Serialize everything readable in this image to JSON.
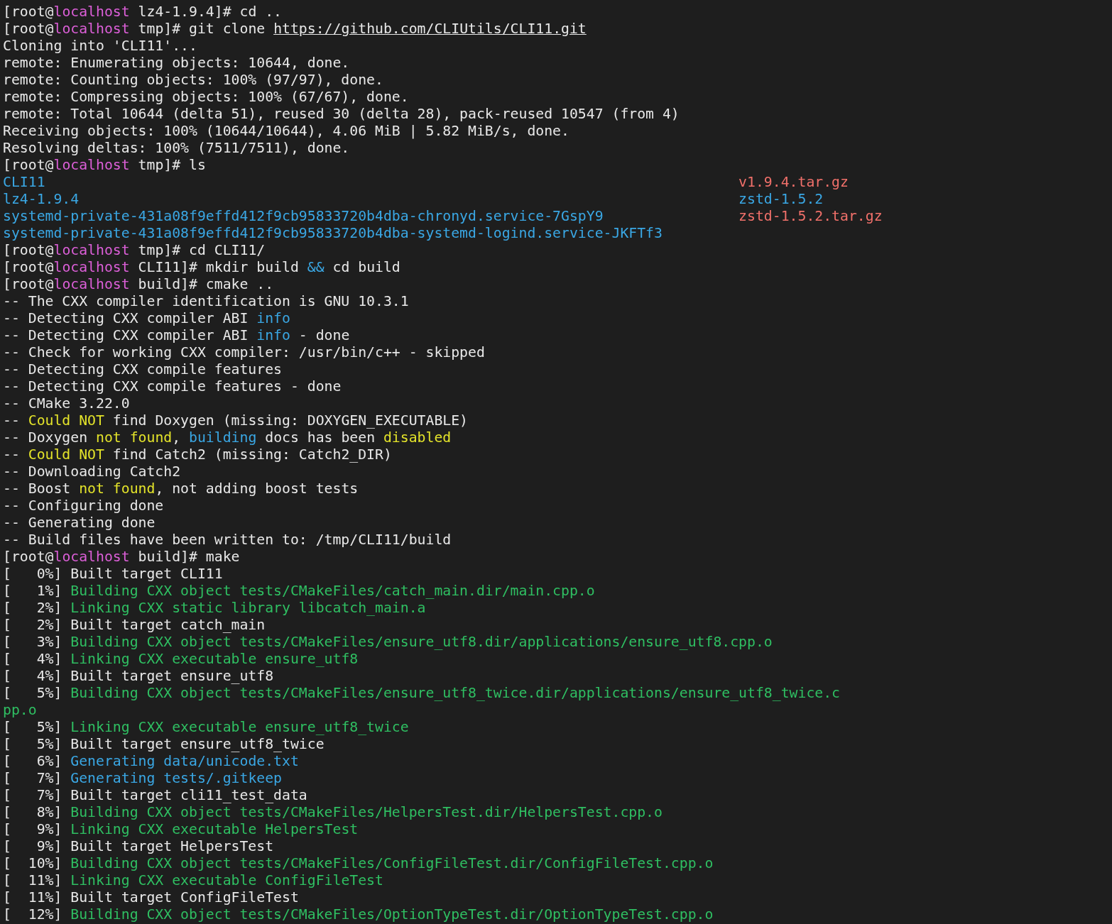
{
  "terminal": {
    "lines": [
      {
        "segments": [
          {
            "text": "[root@",
            "kind": "plain"
          },
          {
            "text": "localhost",
            "kind": "host"
          },
          {
            "text": " lz4-1.9.4]# cd ..",
            "kind": "plain"
          }
        ]
      },
      {
        "segments": [
          {
            "text": "[root@",
            "kind": "plain"
          },
          {
            "text": "localhost",
            "kind": "host"
          },
          {
            "text": " tmp]# git clone ",
            "kind": "plain"
          },
          {
            "text": "https://github.com/CLIUtils/CLI11.git",
            "kind": "link"
          }
        ]
      },
      {
        "segments": [
          {
            "text": "Cloning into 'CLI11'...",
            "kind": "plain"
          }
        ]
      },
      {
        "segments": [
          {
            "text": "remote: Enumerating objects: 10644, done.",
            "kind": "plain"
          }
        ]
      },
      {
        "segments": [
          {
            "text": "remote: Counting objects: 100% (97/97), done.",
            "kind": "plain"
          }
        ]
      },
      {
        "segments": [
          {
            "text": "remote: Compressing objects: 100% (67/67), done.",
            "kind": "plain"
          }
        ]
      },
      {
        "segments": [
          {
            "text": "remote: Total 10644 (delta 51), reused 30 (delta 28), pack-reused 10547 (from 4)",
            "kind": "plain"
          }
        ]
      },
      {
        "segments": [
          {
            "text": "Receiving objects: 100% (10644/10644), 4.06 MiB | 5.82 MiB/s, done.",
            "kind": "plain"
          }
        ]
      },
      {
        "segments": [
          {
            "text": "Resolving deltas: 100% (7511/7511), done.",
            "kind": "plain"
          }
        ]
      },
      {
        "segments": [
          {
            "text": "[root@",
            "kind": "plain"
          },
          {
            "text": "localhost",
            "kind": "host"
          },
          {
            "text": " tmp]# ls",
            "kind": "plain"
          }
        ]
      },
      {
        "cells": [
          {
            "text": "CLI11",
            "kind": "dir"
          },
          {
            "text": "v1.9.4.tar.gz",
            "kind": "archive"
          }
        ]
      },
      {
        "cells": [
          {
            "text": "lz4-1.9.4",
            "kind": "dir"
          },
          {
            "text": "zstd-1.5.2",
            "kind": "dir"
          }
        ]
      },
      {
        "cells": [
          {
            "text": "systemd-private-431a08f9effd412f9cb95833720b4dba-chronyd.service-7GspY9",
            "kind": "dir"
          },
          {
            "text": "zstd-1.5.2.tar.gz",
            "kind": "archive"
          }
        ]
      },
      {
        "cells": [
          {
            "text": "systemd-private-431a08f9effd412f9cb95833720b4dba-systemd-logind.service-JKFTf3",
            "kind": "dir"
          }
        ]
      },
      {
        "segments": [
          {
            "text": "[root@",
            "kind": "plain"
          },
          {
            "text": "localhost",
            "kind": "host"
          },
          {
            "text": " tmp]# cd CLI11/",
            "kind": "plain"
          }
        ]
      },
      {
        "segments": [
          {
            "text": "[root@",
            "kind": "plain"
          },
          {
            "text": "localhost",
            "kind": "host"
          },
          {
            "text": " CLI11]# mkdir build ",
            "kind": "plain"
          },
          {
            "text": "&&",
            "kind": "blue"
          },
          {
            "text": " cd build",
            "kind": "plain"
          }
        ]
      },
      {
        "segments": [
          {
            "text": "[root@",
            "kind": "plain"
          },
          {
            "text": "localhost",
            "kind": "host"
          },
          {
            "text": " build]# cmake ..",
            "kind": "plain"
          }
        ]
      },
      {
        "segments": [
          {
            "text": "-- The CXX compiler identification is GNU 10.3.1",
            "kind": "plain"
          }
        ]
      },
      {
        "segments": [
          {
            "text": "-- Detecting CXX compiler ABI ",
            "kind": "plain"
          },
          {
            "text": "info",
            "kind": "blue"
          }
        ]
      },
      {
        "segments": [
          {
            "text": "-- Detecting CXX compiler ABI ",
            "kind": "plain"
          },
          {
            "text": "info",
            "kind": "blue"
          },
          {
            "text": " - done",
            "kind": "plain"
          }
        ]
      },
      {
        "segments": [
          {
            "text": "-- Check for working CXX compiler: /usr/bin/c++ - skipped",
            "kind": "plain"
          }
        ]
      },
      {
        "segments": [
          {
            "text": "-- Detecting CXX compile features",
            "kind": "plain"
          }
        ]
      },
      {
        "segments": [
          {
            "text": "-- Detecting CXX compile features - done",
            "kind": "plain"
          }
        ]
      },
      {
        "segments": [
          {
            "text": "-- CMake 3.22.0",
            "kind": "plain"
          }
        ]
      },
      {
        "segments": [
          {
            "text": "-- ",
            "kind": "plain"
          },
          {
            "text": "Could NOT",
            "kind": "yellow"
          },
          {
            "text": " find Doxygen (missing: DOXYGEN_EXECUTABLE)",
            "kind": "plain"
          }
        ]
      },
      {
        "segments": [
          {
            "text": "-- Doxygen ",
            "kind": "plain"
          },
          {
            "text": "not found",
            "kind": "yellow"
          },
          {
            "text": ", ",
            "kind": "plain"
          },
          {
            "text": "building",
            "kind": "blue"
          },
          {
            "text": " docs has been ",
            "kind": "plain"
          },
          {
            "text": "disabled",
            "kind": "yellow"
          }
        ]
      },
      {
        "segments": [
          {
            "text": "-- ",
            "kind": "plain"
          },
          {
            "text": "Could NOT",
            "kind": "yellow"
          },
          {
            "text": " find Catch2 (missing: Catch2_DIR)",
            "kind": "plain"
          }
        ]
      },
      {
        "segments": [
          {
            "text": "-- Downloading Catch2",
            "kind": "plain"
          }
        ]
      },
      {
        "segments": [
          {
            "text": "-- Boost ",
            "kind": "plain"
          },
          {
            "text": "not found",
            "kind": "yellow"
          },
          {
            "text": ", not adding boost tests",
            "kind": "plain"
          }
        ]
      },
      {
        "segments": [
          {
            "text": "-- Configuring done",
            "kind": "plain"
          }
        ]
      },
      {
        "segments": [
          {
            "text": "-- Generating done",
            "kind": "plain"
          }
        ]
      },
      {
        "segments": [
          {
            "text": "-- Build files have been written to: /tmp/CLI11/build",
            "kind": "plain"
          }
        ]
      },
      {
        "segments": [
          {
            "text": "[root@",
            "kind": "plain"
          },
          {
            "text": "localhost",
            "kind": "host"
          },
          {
            "text": " build]# make",
            "kind": "plain"
          }
        ]
      },
      {
        "segments": [
          {
            "text": "[   0%] Built target CLI11",
            "kind": "plain"
          }
        ]
      },
      {
        "segments": [
          {
            "text": "[   1%] ",
            "kind": "plain"
          },
          {
            "text": "Building CXX object tests/CMakeFiles/catch_main.dir/main.cpp.o",
            "kind": "green"
          }
        ]
      },
      {
        "segments": [
          {
            "text": "[   2%] ",
            "kind": "plain"
          },
          {
            "text": "Linking CXX static library libcatch_main.a",
            "kind": "green"
          }
        ]
      },
      {
        "segments": [
          {
            "text": "[   2%] Built target catch_main",
            "kind": "plain"
          }
        ]
      },
      {
        "segments": [
          {
            "text": "[   3%] ",
            "kind": "plain"
          },
          {
            "text": "Building CXX object tests/CMakeFiles/ensure_utf8.dir/applications/ensure_utf8.cpp.o",
            "kind": "green"
          }
        ]
      },
      {
        "segments": [
          {
            "text": "[   4%] ",
            "kind": "plain"
          },
          {
            "text": "Linking CXX executable ensure_utf8",
            "kind": "green"
          }
        ]
      },
      {
        "segments": [
          {
            "text": "[   4%] Built target ensure_utf8",
            "kind": "plain"
          }
        ]
      },
      {
        "segments": [
          {
            "text": "[   5%] ",
            "kind": "plain"
          },
          {
            "text": "Building CXX object tests/CMakeFiles/ensure_utf8_twice.dir/applications/ensure_utf8_twice.c",
            "kind": "green"
          }
        ]
      },
      {
        "segments": [
          {
            "text": "pp.o",
            "kind": "green"
          }
        ]
      },
      {
        "segments": [
          {
            "text": "[   5%] ",
            "kind": "plain"
          },
          {
            "text": "Linking CXX executable ensure_utf8_twice",
            "kind": "green"
          }
        ]
      },
      {
        "segments": [
          {
            "text": "[   5%] Built target ensure_utf8_twice",
            "kind": "plain"
          }
        ]
      },
      {
        "segments": [
          {
            "text": "[   6%] ",
            "kind": "plain"
          },
          {
            "text": "Generating data/unicode.txt",
            "kind": "blue"
          }
        ]
      },
      {
        "segments": [
          {
            "text": "[   7%] ",
            "kind": "plain"
          },
          {
            "text": "Generating tests/.gitkeep",
            "kind": "blue"
          }
        ]
      },
      {
        "segments": [
          {
            "text": "[   7%] Built target cli11_test_data",
            "kind": "plain"
          }
        ]
      },
      {
        "segments": [
          {
            "text": "[   8%] ",
            "kind": "plain"
          },
          {
            "text": "Building CXX object tests/CMakeFiles/HelpersTest.dir/HelpersTest.cpp.o",
            "kind": "green"
          }
        ]
      },
      {
        "segments": [
          {
            "text": "[   9%] ",
            "kind": "plain"
          },
          {
            "text": "Linking CXX executable HelpersTest",
            "kind": "green"
          }
        ]
      },
      {
        "segments": [
          {
            "text": "[   9%] Built target HelpersTest",
            "kind": "plain"
          }
        ]
      },
      {
        "segments": [
          {
            "text": "[  10%] ",
            "kind": "plain"
          },
          {
            "text": "Building CXX object tests/CMakeFiles/ConfigFileTest.dir/ConfigFileTest.cpp.o",
            "kind": "green"
          }
        ]
      },
      {
        "segments": [
          {
            "text": "[  11%] ",
            "kind": "plain"
          },
          {
            "text": "Linking CXX executable ConfigFileTest",
            "kind": "green"
          }
        ]
      },
      {
        "segments": [
          {
            "text": "[  11%] Built target ConfigFileTest",
            "kind": "plain"
          }
        ]
      },
      {
        "segments": [
          {
            "text": "[  12%] ",
            "kind": "plain"
          },
          {
            "text": "Building CXX object tests/CMakeFiles/OptionTypeTest.dir/OptionTypeTest.cpp.o",
            "kind": "green"
          }
        ]
      }
    ]
  }
}
